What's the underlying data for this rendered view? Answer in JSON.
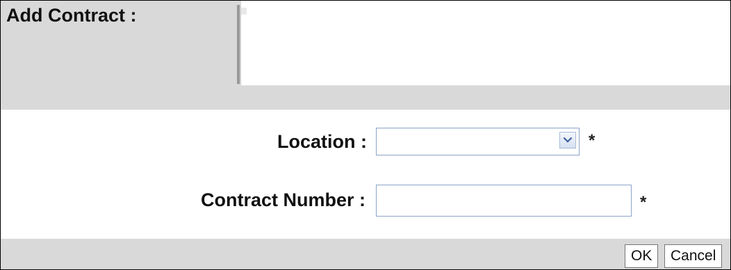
{
  "header": {
    "title": "Add Contract :"
  },
  "form": {
    "location": {
      "label": "Location :",
      "value": "",
      "required_marker": "*"
    },
    "contract_number": {
      "label": "Contract Number :",
      "value": "",
      "placeholder": "",
      "required_marker": "*"
    }
  },
  "buttons": {
    "ok_label": "OK",
    "cancel_label": "Cancel"
  },
  "icons": {
    "dropdown": "chevron-down-icon"
  },
  "colors": {
    "panel_gray": "#d9d9d9",
    "input_border": "#8aa4c8"
  }
}
